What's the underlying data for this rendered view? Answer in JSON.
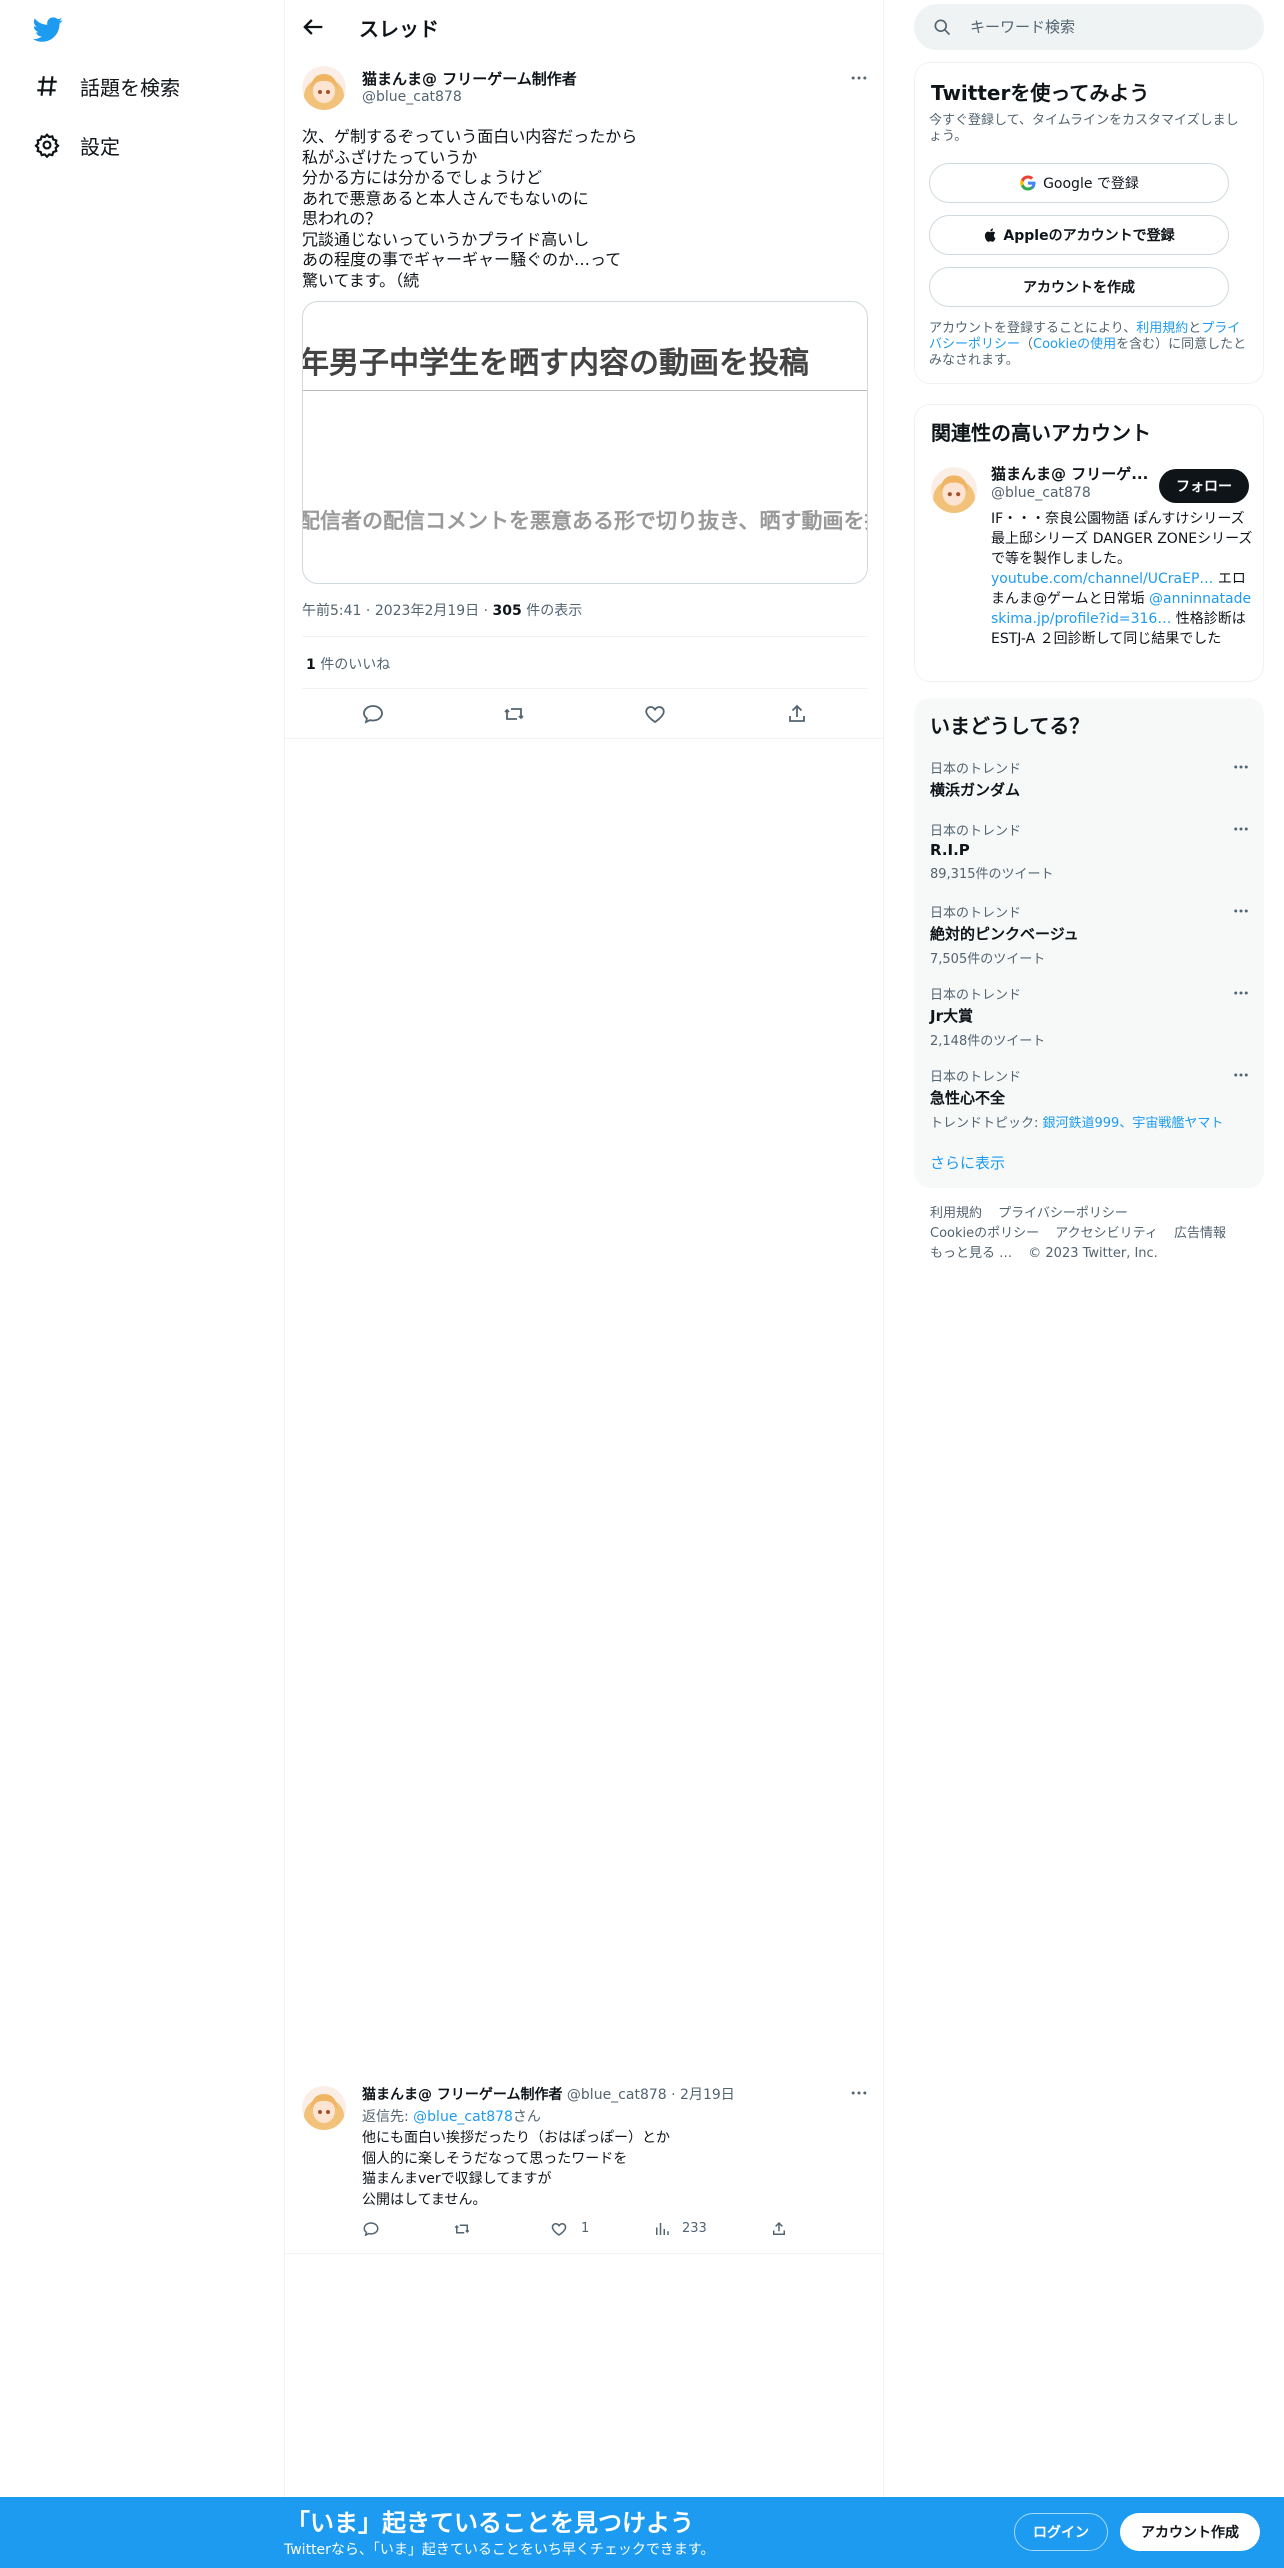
{
  "nav": {
    "logo_icon": "twitter-bird-icon",
    "items": [
      {
        "label": "話題を検索",
        "icon": "hash-icon"
      },
      {
        "label": "設定",
        "icon": "gear-icon"
      }
    ]
  },
  "header": {
    "title": "スレッド"
  },
  "tweet": {
    "author_name": "猫まんま@ フリーゲーム制作者",
    "author_handle": "@blue_cat878",
    "lines": [
      "次、ゲ制するぞっていう面白い内容だったから",
      "私がふざけたっていうか",
      "分かる方には分かるでしょうけど",
      "あれで悪意あると本人さんでもないのに",
      "思われの？",
      "冗談通じないっていうかプライド高いし",
      "あの程度の事でギャーギャー騒ぐのか…って",
      "驚いてます。（続"
    ],
    "card_line1": "年男子中学生を晒す内容の動画を投稿",
    "card_line2": "配信者の配信コメントを悪意ある形で切り抜き、晒す動画を投",
    "time": "午前5:41",
    "date": "2023年2月19日",
    "views_count": "305",
    "views_label": " 件の表示",
    "likes_count": "1",
    "likes_label": " 件のいいね"
  },
  "reply": {
    "author_name": "猫まんま@ フリーゲーム制作者",
    "author_handle": "@blue_cat878",
    "date": "2月19日",
    "reply_to_prefix": "返信先: ",
    "reply_to_handle": "@blue_cat878",
    "reply_to_suffix": "さん",
    "lines": [
      "他にも面白い挨拶だったり（おはぽっぽー）とか",
      "個人的に楽しそうだなって思ったワードを",
      "猫まんまverで収録してますが",
      "公開はしてません。"
    ],
    "like_count": "1",
    "view_count": "233"
  },
  "search": {
    "placeholder": "キーワード検索"
  },
  "signup_box": {
    "title": "Twitterを使ってみよう",
    "subtitle": "今すぐ登録して、タイムラインをカスタマイズしましょう。",
    "google_label": "Google で登録",
    "apple_label": "Appleのアカウントで登録",
    "create_label": "アカウントを作成",
    "legal_prefix": "アカウントを登録することにより、",
    "legal_terms": "利用規約",
    "legal_and": "と",
    "legal_privacy": "プライバシーポリシー",
    "legal_open": "（",
    "legal_cookie": "Cookieの使用",
    "legal_suffix": "を含む）に同意したとみなされます。"
  },
  "related": {
    "title": "関連性の高いアカウント",
    "name": "猫まんま@ フリーゲ...",
    "handle": "@blue_cat878",
    "follow_label": "フォロー",
    "bio_1": "IF・・・奈良公園物語 ぽんすけシリーズ 最上邸シリーズ DANGER ZONEシリーズ で等を製作しました。",
    "bio_link1": "youtube.com/channel/UCraEP…",
    "bio_2": " エロまんま@ゲームと日常垢 ",
    "bio_link2": "@anninnatade",
    "bio_link3": "skima.jp/profile?id=316…",
    "bio_3": " 性格診断はESTJ-A ２回診断して同じ結果でした"
  },
  "trends": {
    "title": "いまどうしてる？",
    "items": [
      {
        "category": "日本のトレンド",
        "name": "横浜ガンダム",
        "count": ""
      },
      {
        "category": "日本のトレンド",
        "name": "R.I.P",
        "count": "89,315件のツイート"
      },
      {
        "category": "日本のトレンド",
        "name": "絶対的ピンクベージュ",
        "count": "7,505件のツイート"
      },
      {
        "category": "日本のトレンド",
        "name": "Jr大賞",
        "count": "2,148件のツイート"
      },
      {
        "category": "日本のトレンド",
        "name": "急性心不全",
        "count": ""
      }
    ],
    "topic_prefix": "トレンドトピック: ",
    "topic_links": "銀河鉄道999、宇宙戦艦ヤマト",
    "show_more": "さらに表示"
  },
  "footer": {
    "terms": "利用規約",
    "privacy": "プライバシーポリシー",
    "cookie": "Cookieのポリシー",
    "accessibility": "アクセシビリティ",
    "ads": "広告情報",
    "more": "もっと見る …",
    "copyright": "© 2023 Twitter, Inc."
  },
  "banner": {
    "title": "「いま」起きていることを見つけよう",
    "subtitle": "Twitterなら、「いま」起きていることをいち早くチェックできます。",
    "login_label": "ログイン",
    "signup_label": "アカウント作成"
  },
  "colors": {
    "accent": "#1d9bf0",
    "text": "#0f1419",
    "secondary": "#536471",
    "border": "#eff3f4"
  }
}
